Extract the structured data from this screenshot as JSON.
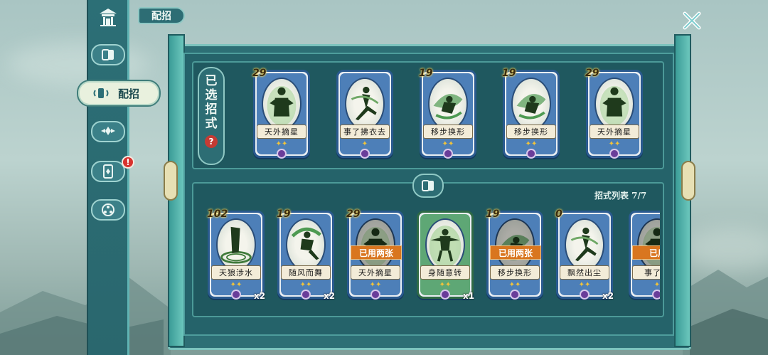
{
  "header": {
    "title": "配招"
  },
  "nav": {
    "active_label": "配招",
    "badge": "!"
  },
  "selected_panel": {
    "label_chars": [
      "已",
      "选",
      "招",
      "式"
    ],
    "help": "?",
    "cards": [
      {
        "cost": "29",
        "name": "天外摘星",
        "stars": "✦✦",
        "figure": "standing",
        "tint": "blue"
      },
      {
        "cost": "",
        "name": "事了拂衣去",
        "stars": "✦",
        "figure": "kick",
        "tint": "blue"
      },
      {
        "cost": "19",
        "name": "移步换形",
        "stars": "✦✦",
        "figure": "swirl",
        "tint": "blue"
      },
      {
        "cost": "19",
        "name": "移步换形",
        "stars": "✦✦",
        "figure": "swirl",
        "tint": "blue"
      },
      {
        "cost": "29",
        "name": "天外摘星",
        "stars": "✦✦",
        "figure": "standing",
        "tint": "blue"
      }
    ]
  },
  "list_panel": {
    "count_label": "招式列表 7/7",
    "cards": [
      {
        "cost": "102",
        "name": "天狼涉水",
        "stars": "✦✦",
        "qty": "x2",
        "used": "",
        "figure": "water",
        "tint": "blue"
      },
      {
        "cost": "19",
        "name": "随风而舞",
        "stars": "✦✦",
        "qty": "x2",
        "used": "",
        "figure": "leap",
        "tint": "blue"
      },
      {
        "cost": "29",
        "name": "天外摘星",
        "stars": "✦✦",
        "qty": "",
        "used": "已用两张",
        "figure": "standing",
        "tint": "blue"
      },
      {
        "cost": "",
        "name": "身随意转",
        "stars": "✦✦",
        "qty": "x1",
        "used": "",
        "figure": "spin",
        "tint": "green"
      },
      {
        "cost": "19",
        "name": "移步换形",
        "stars": "✦✦",
        "qty": "",
        "used": "已用两张",
        "figure": "swirl",
        "tint": "blue"
      },
      {
        "cost": "0",
        "name": "飘然出尘",
        "stars": "✦✦",
        "qty": "x2",
        "used": "",
        "figure": "kick",
        "tint": "blue"
      },
      {
        "cost": "",
        "name": "事了拂",
        "stars": "✦",
        "qty": "",
        "used": "已用",
        "figure": "standing",
        "tint": "blue"
      }
    ]
  },
  "icons": {
    "top": "pavilion-icon",
    "close": "close-x-icon",
    "emblem": "card-stack-icon"
  },
  "colors": {
    "panel": "#2d6f75",
    "card_blue": "#4d7fb8",
    "card_green": "#5ea775",
    "used_badge": "#d9761f",
    "badge_red": "#d8322e"
  }
}
